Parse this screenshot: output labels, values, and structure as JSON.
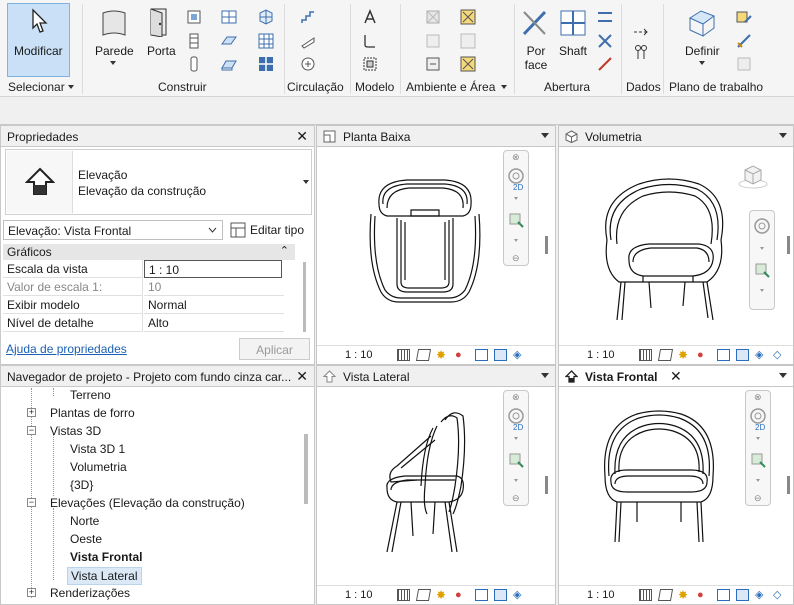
{
  "ribbon": {
    "modify": "Modificar",
    "wall": "Parede",
    "door": "Porta",
    "by_face": "Por face",
    "shaft": "Shaft",
    "set": "Definir",
    "groups": {
      "select": "Selecionar",
      "build": "Construir",
      "circulation": "Circulação",
      "model": "Modelo",
      "room_area": "Ambiente e Área",
      "opening": "Abertura",
      "datum": "Dados",
      "work_plane": "Plano de trabalho"
    }
  },
  "properties": {
    "title": "Propriedades",
    "type_line1": "Elevação",
    "type_line2": "Elevação da construção",
    "selector": "Elevação: Vista Frontal",
    "edit_type": "Editar tipo",
    "section": "Gráficos",
    "rows": [
      {
        "label": "Escala da vista",
        "value": "1 : 10"
      },
      {
        "label": "Valor de escala    1:",
        "value": "10"
      },
      {
        "label": "Exibir modelo",
        "value": "Normal"
      },
      {
        "label": "Nível de detalhe",
        "value": "Alto"
      }
    ],
    "help": "Ajuda de propriedades",
    "apply": "Aplicar"
  },
  "browser": {
    "title": "Navegador de projeto - Projeto com fundo cinza car...",
    "items": [
      "Terreno",
      "Plantas de forro",
      "Vistas 3D",
      "Vista 3D 1",
      "Volumetria",
      "{3D}",
      "Elevações (Elevação da construção)",
      "Norte",
      "Oeste",
      "Vista Frontal",
      "Vista Lateral",
      "Renderizações"
    ]
  },
  "views": {
    "plan": {
      "title": "Planta Baixa",
      "scale": "1 : 10"
    },
    "volume": {
      "title": "Volumetria",
      "scale": "1 : 10"
    },
    "side": {
      "title": "Vista Lateral",
      "scale": "1 : 10"
    },
    "front": {
      "title": "Vista Frontal",
      "scale": "1 : 10"
    }
  },
  "navbar": {
    "label2d": "2D"
  },
  "colors": {
    "accent": "#c9e0f7",
    "accent_border": "#7fb2e5",
    "link": "#1a5fb4",
    "panel_head": "#f0f0f0"
  }
}
